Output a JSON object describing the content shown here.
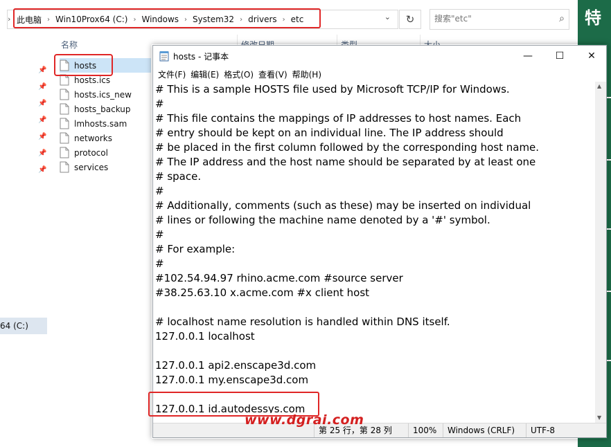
{
  "explorer": {
    "breadcrumbs": [
      "此电脑",
      "Win10Prox64 (C:)",
      "Windows",
      "System32",
      "drivers",
      "etc"
    ],
    "search": {
      "placeholder": "搜索\"etc\""
    },
    "columns": {
      "name": "名称",
      "modified": "修改日期",
      "type": "类型",
      "size": "大小"
    },
    "files": [
      "hosts",
      "hosts.ics",
      "hosts.ics_new",
      "hosts_backup",
      "lmhosts.sam",
      "networks",
      "protocol",
      "services"
    ],
    "nav_drive": "64 (C:)"
  },
  "side_banner": {
    "char": "特"
  },
  "notepad": {
    "title": "hosts - 记事本",
    "menu": [
      "文件(F)",
      "编辑(E)",
      "格式(O)",
      "查看(V)",
      "帮助(H)"
    ],
    "window_controls": {
      "minimize": "—",
      "maximize": "☐",
      "close": "✕"
    },
    "text": "# This is a sample HOSTS file used by Microsoft TCP/IP for Windows.\n#\n# This file contains the mappings of IP addresses to host names. Each\n# entry should be kept on an individual line. The IP address should\n# be placed in the first column followed by the corresponding host name.\n# The IP address and the host name should be separated by at least one\n# space.\n#\n# Additionally, comments (such as these) may be inserted on individual\n# lines or following the machine name denoted by a '#' symbol.\n#\n# For example:\n#\n#102.54.94.97 rhino.acme.com #source server\n#38.25.63.10 x.acme.com #x client host\n\n# localhost name resolution is handled within DNS itself.\n127.0.0.1 localhost\n\n127.0.0.1 api2.enscape3d.com\n127.0.0.1 my.enscape3d.com\n\n127.0.0.1 id.autodessys.com",
    "status": {
      "position": "第 25 行，第 28 列",
      "zoom": "100%",
      "line_ending": "Windows (CRLF)",
      "encoding": "UTF-8"
    }
  },
  "watermark": "www.dgrai.com",
  "colors": {
    "highlight": "#e02626",
    "banner": "#1c6b48",
    "selection": "#cce4f7"
  }
}
